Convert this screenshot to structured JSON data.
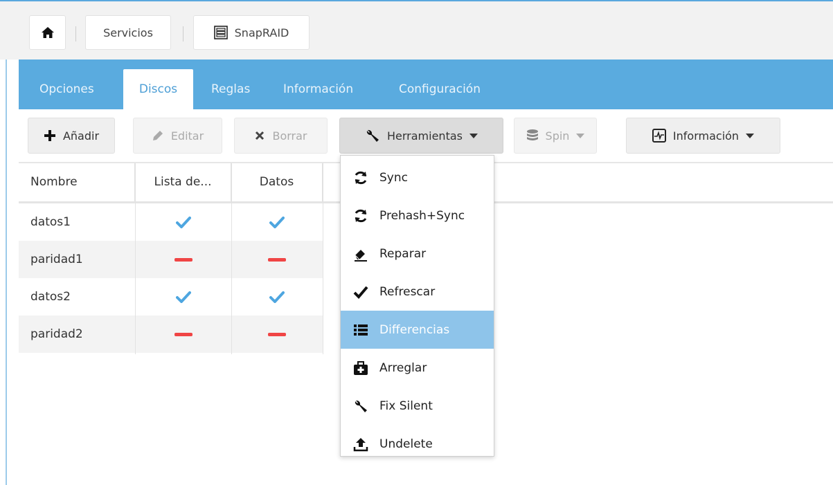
{
  "breadcrumb": {
    "home_icon": "home-icon",
    "items": [
      "Servicios",
      "SnapRAID"
    ]
  },
  "tabs": [
    "Opciones",
    "Discos",
    "Reglas",
    "Información",
    "Configuración"
  ],
  "active_tab": "Discos",
  "toolbar": {
    "add": "Añadir",
    "edit": "Editar",
    "delete": "Borrar",
    "tools": "Herramientas",
    "spin": "Spin",
    "info": "Información"
  },
  "table": {
    "columns": [
      "Nombre",
      "Lista de...",
      "Datos"
    ],
    "rows": [
      {
        "name": "datos1",
        "content": true,
        "data": true
      },
      {
        "name": "paridad1",
        "content": false,
        "data": false
      },
      {
        "name": "datos2",
        "content": true,
        "data": true
      },
      {
        "name": "paridad2",
        "content": false,
        "data": false
      }
    ]
  },
  "tools_menu": {
    "items": [
      {
        "label": "Sync",
        "icon": "refresh-icon"
      },
      {
        "label": "Prehash+Sync",
        "icon": "refresh-icon"
      },
      {
        "label": "Reparar",
        "icon": "eraser-icon"
      },
      {
        "label": "Refrescar",
        "icon": "check-icon"
      },
      {
        "label": "Differencias",
        "icon": "list-icon"
      },
      {
        "label": "Arreglar",
        "icon": "medkit-icon"
      },
      {
        "label": "Fix Silent",
        "icon": "wrench-icon"
      },
      {
        "label": "Undelete",
        "icon": "upload-icon"
      }
    ],
    "highlighted": "Differencias"
  },
  "colors": {
    "accent": "#5aabdf",
    "check": "#4ea6e0",
    "dash": "#f04545",
    "highlight": "#8ec4ea"
  }
}
